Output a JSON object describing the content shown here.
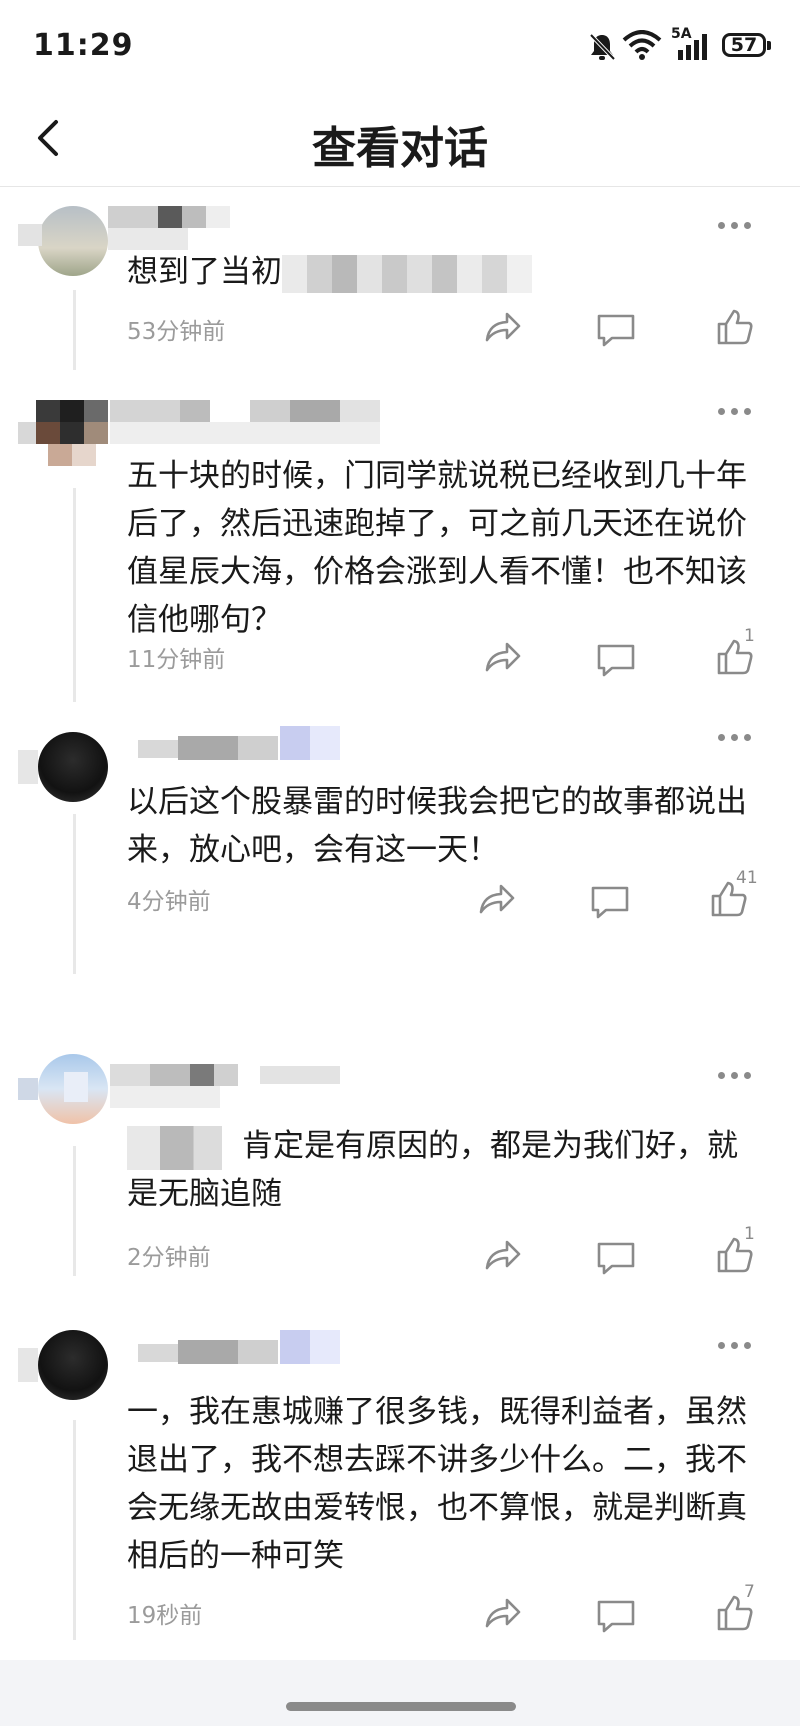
{
  "status_bar": {
    "time": "11:29",
    "battery": "57",
    "network": "5A"
  },
  "header": {
    "title": "查看对话"
  },
  "comments": [
    {
      "text_visible": "想到了当初",
      "time": "53分钟前",
      "likes": ""
    },
    {
      "text_visible": "五十块的时候，门同学就说税已经收到几十年后了，然后迅速跑掉了，可之前几天还在说价值星辰大海，价格会涨到人看不懂！也不知该信他哪句？",
      "time": "11分钟前",
      "likes": "1"
    },
    {
      "text_visible": "以后这个股暴雷的时候我会把它的故事都说出来，放心吧，会有这一天！",
      "time": "4分钟前",
      "likes": "41"
    },
    {
      "text_visible": "肯定是有原因的，都是为我们好，就是无脑追随",
      "time": "2分钟前",
      "likes": "1"
    },
    {
      "text_visible": "一，我在惠城赚了很多钱，既得利益者，虽然退出了，我不想去踩不讲多少什么。二，我不会无缘无故由爱转恨，也不算恨，就是判断真相后的一种可笑",
      "time": "19秒前",
      "likes": "7"
    }
  ],
  "icons": {
    "back": "chevron-left-icon",
    "share": "share-arrow-icon",
    "comment": "comment-bubble-icon",
    "like": "thumbs-up-icon",
    "more": "more-dots-icon"
  },
  "colors": {
    "meta_text": "#9b9b9b",
    "icon": "#8a8a8a",
    "divider": "#e6e6e6"
  }
}
